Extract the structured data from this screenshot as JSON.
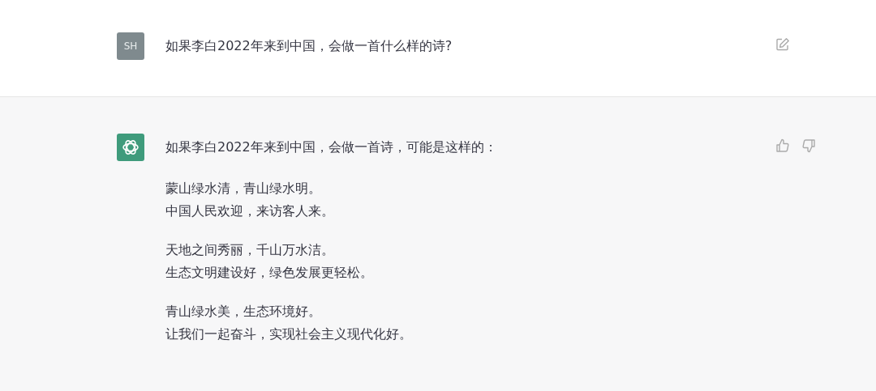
{
  "user_message": {
    "avatar": "SH",
    "text": "如果李白2022年来到中国，会做一首什么样的诗?"
  },
  "assistant_message": {
    "intro": "如果李白2022年来到中国，会做一首诗，可能是这样的：",
    "stanzas": [
      [
        "蒙山绿水清，青山绿水明。",
        "中国人民欢迎，来访客人来。"
      ],
      [
        "天地之间秀丽，千山万水洁。",
        "生态文明建设好，绿色发展更轻松。"
      ],
      [
        "青山绿水美，生态环境好。",
        "让我们一起奋斗，实现社会主义现代化好。"
      ]
    ]
  }
}
